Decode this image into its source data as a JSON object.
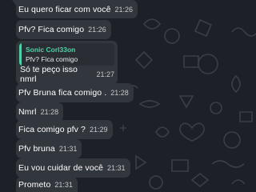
{
  "chat": {
    "messages": [
      {
        "text": "Eu quero ficar com você",
        "time": "21:26"
      },
      {
        "text": "Pfv? Fica comigo",
        "time": "21:26"
      },
      {
        "reply": {
          "author": "Sonic Corl33on",
          "quoted": "Pfv? Fica comigo"
        },
        "text": "Só te peço isso nmrl",
        "time": "21:27"
      },
      {
        "text": "Pfv Bruna fica comigo .",
        "time": "21:28"
      },
      {
        "text": "Nmrl",
        "time": "21:28"
      },
      {
        "text": "Fica comigo pfv ?",
        "time": "21:29"
      },
      {
        "text": "Pfv bruna",
        "time": "21:31"
      },
      {
        "text": "Eu vou cuidar de você",
        "time": "21:31"
      },
      {
        "text": "Prometo",
        "time": "21:31"
      }
    ]
  },
  "colors": {
    "background": "#1d2026",
    "bubble": "#32363d",
    "reply_accent": "#4fd1a5"
  }
}
